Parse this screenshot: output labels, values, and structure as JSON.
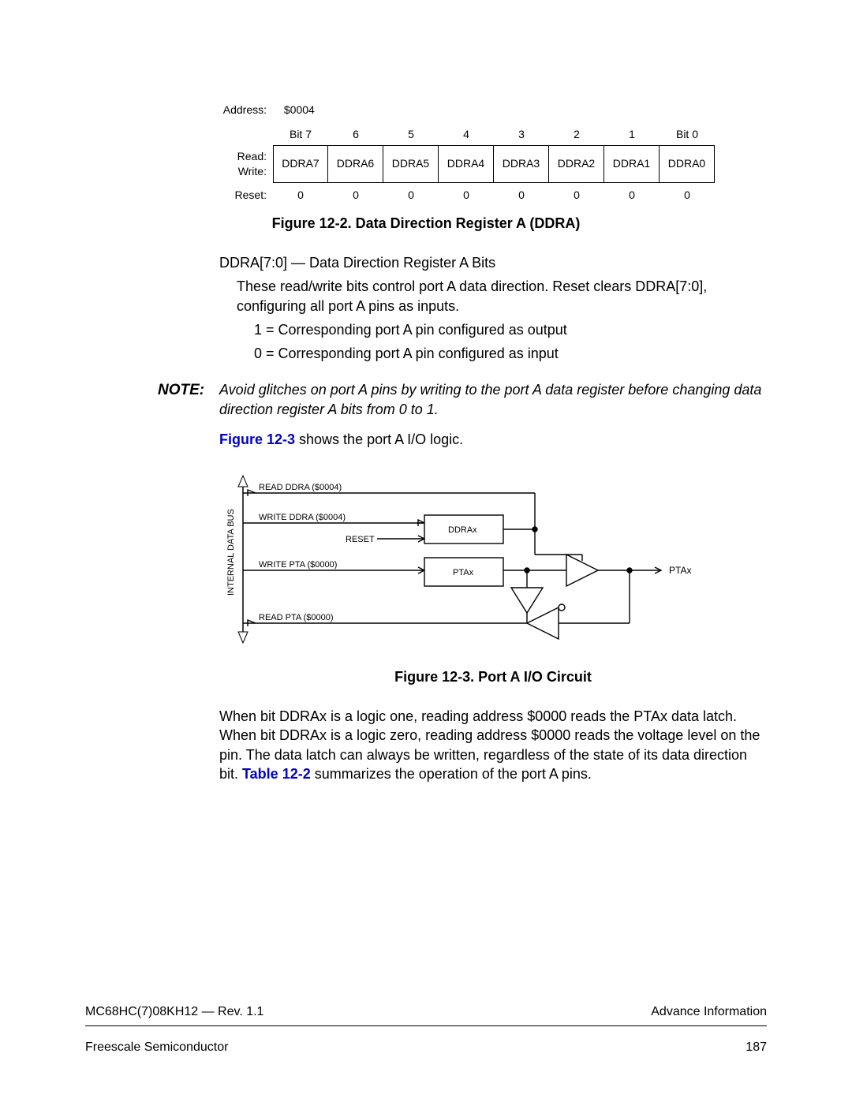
{
  "register": {
    "address_label": "Address:",
    "address_value": "$0004",
    "bit_headers": [
      "Bit 7",
      "6",
      "5",
      "4",
      "3",
      "2",
      "1",
      "Bit 0"
    ],
    "read_label": "Read:",
    "write_label": "Write:",
    "bits": [
      "DDRA7",
      "DDRA6",
      "DDRA5",
      "DDRA4",
      "DDRA3",
      "DDRA2",
      "DDRA1",
      "DDRA0"
    ],
    "reset_label": "Reset:",
    "reset_values": [
      "0",
      "0",
      "0",
      "0",
      "0",
      "0",
      "0",
      "0"
    ]
  },
  "caption1": "Figure 12-2. Data Direction Register A (DDRA)",
  "body": {
    "line1": "DDRA[7:0] — Data Direction Register A Bits",
    "line2": "These read/write bits control port A data direction. Reset clears DDRA[7:0], configuring all port A pins as inputs.",
    "line3": "1 = Corresponding port A pin configured as output",
    "line4": "0 = Corresponding port A pin configured as input"
  },
  "note": {
    "label": "NOTE:",
    "text": "Avoid glitches on port A pins by writing to the port A data register before changing data direction register A bits from 0 to 1."
  },
  "after_note": {
    "link": "Figure 12-3",
    "rest": " shows the port A I/O logic."
  },
  "diagram": {
    "bus_label": "INTERNAL DATA BUS",
    "l1": "READ DDRA ($0004)",
    "l2": "WRITE DDRA ($0004)",
    "reset": "RESET",
    "box1": "DDRAx",
    "l3": "WRITE PTA ($0000)",
    "box2": "PTAx",
    "l4": "READ PTA ($0000)",
    "out": "PTAx"
  },
  "caption2": "Figure 12-3. Port A I/O Circuit",
  "para2": {
    "t1": "When bit DDRAx is a logic one, reading address $0000 reads the PTAx data latch. When bit DDRAx is a logic zero, reading address $0000 reads the voltage level on the pin. The data latch can always be written, regardless of the state of its data direction bit. ",
    "link": "Table 12-2",
    "t2": " summarizes the operation of the port A pins."
  },
  "footer": {
    "doc": "MC68HC(7)08KH12 — Rev. 1.1",
    "right1": "Advance Information",
    "left2": "Freescale Semiconductor",
    "page": "187"
  }
}
